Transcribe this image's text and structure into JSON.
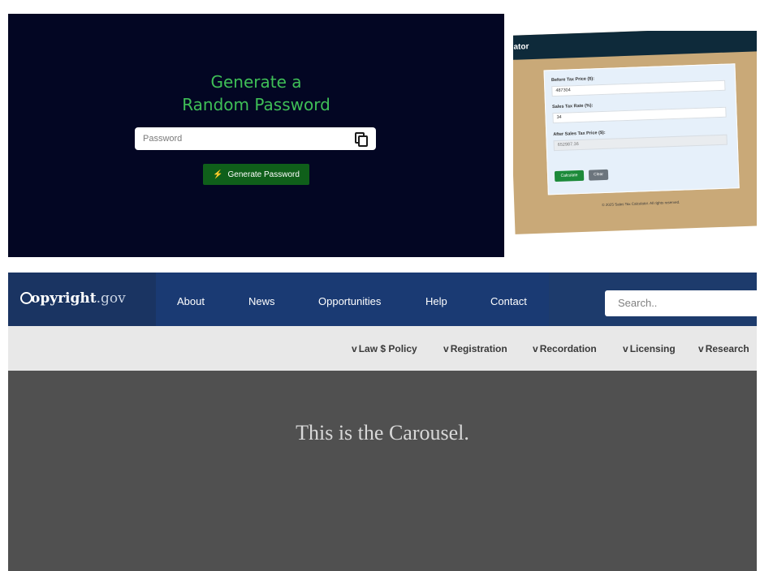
{
  "password_app": {
    "title_line1": "Generate a",
    "title_line2": "Random Password",
    "input_placeholder": "Password",
    "copy_icon": "copy-icon",
    "button_label": "Generate Password",
    "button_icon": "bolt-icon",
    "colors": {
      "background": "#030623",
      "title": "#3fbf57",
      "button": "#0f5f1a"
    }
  },
  "tax_app": {
    "header_title": "ator",
    "before_label": "Before Tax Price ($):",
    "before_value": "487304",
    "rate_label": "Sales Tax Rate (%):",
    "rate_value": "34",
    "after_label": "After Sales Tax Price ($):",
    "after_value": "652987.36",
    "calculate_label": "Calculate",
    "clear_label": "Clear",
    "footer": "© 2025 Sales Tax Calculator. All rights reserved.",
    "colors": {
      "background": "#c9a978",
      "header": "#0e2a3a",
      "card": "#e6f0fa"
    }
  },
  "copyright_site": {
    "logo_main": "opyright",
    "logo_suffix": ".gov",
    "nav_links": [
      "About",
      "News",
      "Opportunities",
      "Help",
      "Contact"
    ],
    "search_placeholder": "Search..",
    "sub_nav": [
      "Law $ Policy",
      "Registration",
      "Recordation",
      "Licensing",
      "Research"
    ],
    "chevron": "v",
    "carousel_text": "This is the Carousel.",
    "colors": {
      "nav": "#1d3b6c",
      "subnav": "#e8e8e8",
      "carousel": "#505050"
    }
  }
}
